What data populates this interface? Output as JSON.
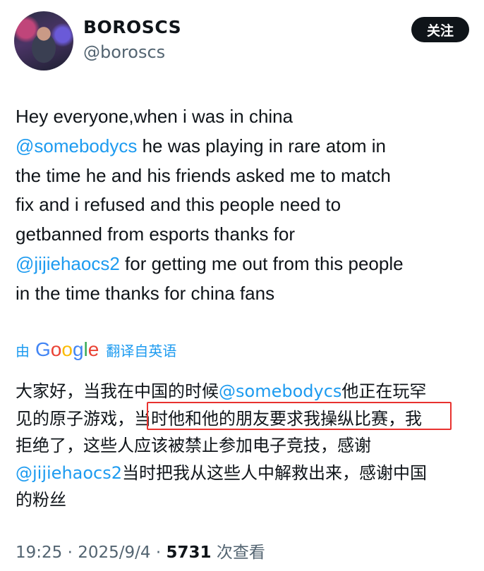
{
  "author": {
    "display_name": "BOROSCS",
    "handle": "@boroscs"
  },
  "follow_button": {
    "label": "关注"
  },
  "tweet": {
    "lines": [
      [
        {
          "t": "Hey everyone,when i was in china"
        }
      ],
      [
        {
          "t": "@somebodycs",
          "m": true
        },
        {
          "t": " he was playing in rare atom in"
        }
      ],
      [
        {
          "t": "the time he and his friends asked me to match"
        }
      ],
      [
        {
          "t": "fix and i refused and this people need to"
        }
      ],
      [
        {
          "t": "getbanned from esports thanks for"
        }
      ],
      [
        {
          "t": "@jijiehaocs2",
          "m": true
        },
        {
          "t": " for getting me out from this people"
        }
      ],
      [
        {
          "t": "in the time thanks for china fans"
        }
      ]
    ]
  },
  "translation": {
    "by_label": "由",
    "provider": "Google",
    "provider_colors": [
      "#4285f4",
      "#ea4335",
      "#fbbc05",
      "#4285f4",
      "#34a853",
      "#ea4335"
    ],
    "translated_from": "翻译自英语",
    "lines": [
      [
        {
          "t": "大家好，当我在中国的时候"
        },
        {
          "t": "@somebodycs",
          "m": true
        },
        {
          "t": "他正在玩罕"
        }
      ],
      [
        {
          "t": "见的原子游戏，"
        },
        {
          "t": "当时他和他的朋友要求我操纵比赛，",
          "h": true
        },
        {
          "t": "我"
        }
      ],
      [
        {
          "t": "拒绝了，这些人应该被禁止参加电子竞技，感谢"
        }
      ],
      [
        {
          "t": "@jijiehaocs2",
          "m": true
        },
        {
          "t": "当时把我从这些人中解救出来，感谢中国"
        }
      ],
      [
        {
          "t": "的粉丝"
        }
      ]
    ]
  },
  "meta": {
    "time": "19:25",
    "separator": "·",
    "date": "2025/9/4",
    "views_count": "5731",
    "views_label": "次查看"
  },
  "colors": {
    "mention": "#1d9bf0",
    "highlight_border": "#e8322f",
    "follow_bg": "#0f1419",
    "secondary_text": "#536471"
  }
}
